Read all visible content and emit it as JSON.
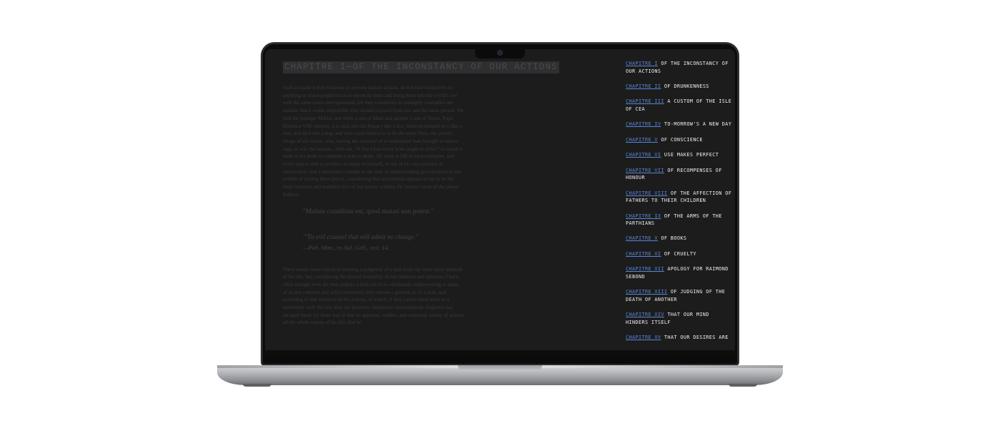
{
  "article": {
    "title": "CHAPITRE I—OF THE INCONSTANCY OF OUR ACTIONS",
    "paragraph_1": "Such as make it their business to oversee human actions, do not find themselves in anything so much perplexed as to reconcile them and bring them into the world's eye with the same lustre and reputation; for they commonly so strangely contradict one another that it seems impossible they should proceed from one and the same person. We find the younger Marius one while a son of Mars and another a son of Venus. Pope Boniface VIII. entered, it is said, into his Papacy like a fox, behaved himself in it like a lion, and died like a dog; and who could believe it to be the same Nero, the perfect image of all cruelty, who, having the sentence of a condemned man brought to him to sign, as was the custom, cried out, \"O that I had never been taught to write!\" so much it went to his heart to condemn a man to death. All story is full of such examples, and every man is able to produce so many to himself, or out of his own practice or observation, that I sometimes wonder to see men of understanding give themselves the trouble of sorting these pieces, considering that irresolution appears to me to be the most common and manifest vice of our nature; witness the famous verse of the player Publius:",
    "quote_latin": "\"Malum consilium est, quod mutari non potest.\"",
    "quote_english": "\"'Tis evil counsel that will admit no change.\"",
    "quote_citation": "—Pub. Mim., ex Aul. Gell., xvii. 14.",
    "paragraph_2": "There seems some reason in forming a judgment of a man from the most usual methods of his life; but, considering the natural instability of our manners and opinions, I have often thought even the best authors a little out in so obstinately endeavouring to make of us any constant and solid contexture; they choose a general air of a man, and according to that interpret all his actions, of which, if they cannot bend some to a uniformity with the rest, they are presently imputed to dissimulation. Augustus has escaped them; for there was in him so apparent, sudden, and continual variety of actions all the whole course of his life, that he"
  },
  "toc": [
    {
      "link": "CHAPITRE I",
      "text": " OF THE INCONSTANCY OF OUR ACTIONS"
    },
    {
      "link": "CHAPITRE II",
      "text": " OF DRUNKENNESS"
    },
    {
      "link": "CHAPITRE III",
      "text": " A CUSTOM OF THE ISLE OF CEA"
    },
    {
      "link": "CHAPITRE IV",
      "text": " TO-MORROW'S A NEW DAY"
    },
    {
      "link": "CHAPITRE V",
      "text": " OF CONSCIENCE"
    },
    {
      "link": "CHAPITRE VI",
      "text": " USE MAKES PERFECT"
    },
    {
      "link": "CHAPITRE VII",
      "text": " OF RECOMPENSES OF HONOUR"
    },
    {
      "link": "CHAPITRE VIII",
      "text": " OF THE AFFECTION OF FATHERS TO THEIR CHILDREN"
    },
    {
      "link": "CHAPITRE IX",
      "text": " OF THE ARMS OF THE PARTHIANS"
    },
    {
      "link": "CHAPITRE X",
      "text": " OF BOOKS"
    },
    {
      "link": "CHAPITRE XI",
      "text": " OF CRUELTY"
    },
    {
      "link": "CHAPITRE XII",
      "text": " APOLOGY FOR RAIMOND SEBOND"
    },
    {
      "link": "CHAPITRE XIII",
      "text": " OF JUDGING OF THE DEATH OF ANOTHER"
    },
    {
      "link": "CHAPITRE XIV",
      "text": " THAT OUR MIND HINDERS ITSELF"
    },
    {
      "link": "CHAPITRE XV",
      "text": " THAT OUR DESIRES ARE"
    }
  ],
  "colors": {
    "background": "#1c1c1d",
    "link": "#5a86d6",
    "toc_text": "#f0f0f0",
    "article_text": "#3a3a3c",
    "title_highlight": "#2f2f31"
  }
}
